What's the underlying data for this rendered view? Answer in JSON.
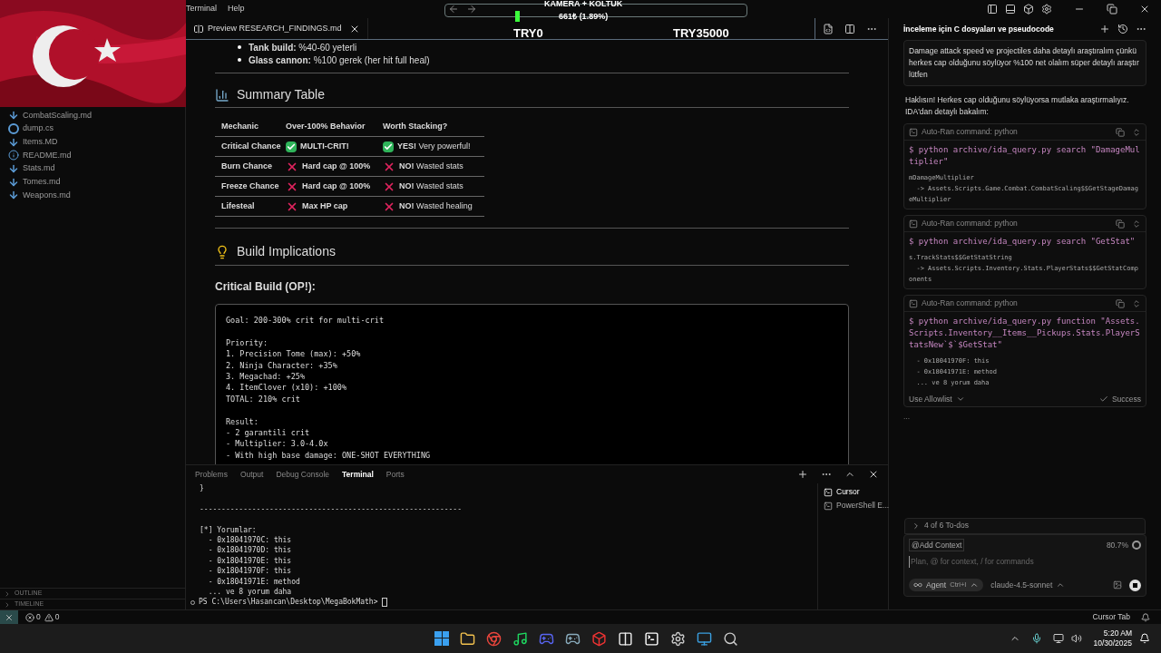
{
  "menu": [
    "Terminal",
    "Help"
  ],
  "stream_overlay": {
    "title": "KAMERA + KOLTUK",
    "amount": "661₺ (1.89%)",
    "start": "TRY0",
    "goal": "TRY35000",
    "level": 0.23
  },
  "sidebar": {
    "files": [
      {
        "name": "CombatScaling.md",
        "kind": "md"
      },
      {
        "name": "dump.cs",
        "kind": "cs"
      },
      {
        "name": "Items.MD",
        "kind": "md"
      },
      {
        "name": "README.md",
        "kind": "info"
      },
      {
        "name": "Stats.md",
        "kind": "md"
      },
      {
        "name": "Tomes.md",
        "kind": "md"
      },
      {
        "name": "Weapons.md",
        "kind": "md"
      }
    ],
    "sections": [
      {
        "label": "OUTLINE",
        "expanded": false
      },
      {
        "label": "TIMELINE",
        "expanded": false
      }
    ]
  },
  "editor_tab": {
    "label": "Preview RESEARCH_FINDINGS.md"
  },
  "preview": {
    "bullets": [
      "**Tank build:** %40-60 yeterli",
      "**Glass cannon:** %100 gerek (her hit full heal)"
    ],
    "summary_heading": "Summary Table",
    "table": {
      "columns": [
        "Mechanic",
        "Over-100% Behavior",
        "Worth Stacking?"
      ],
      "rows": [
        {
          "mechanic": "Critical Chance",
          "behavior": {
            "kind": "yes",
            "text": "MULTI-CRIT!"
          },
          "worth": {
            "kind": "yes",
            "text": "**YES!** Very powerful!"
          }
        },
        {
          "mechanic": "Burn Chance",
          "behavior": {
            "kind": "no",
            "text": "Hard cap @ 100%"
          },
          "worth": {
            "kind": "no",
            "text": "**NO!** Wasted stats"
          }
        },
        {
          "mechanic": "Freeze Chance",
          "behavior": {
            "kind": "no",
            "text": "Hard cap @ 100%"
          },
          "worth": {
            "kind": "no",
            "text": "**NO!** Wasted stats"
          }
        },
        {
          "mechanic": "Lifesteal",
          "behavior": {
            "kind": "no",
            "text": "Max HP cap"
          },
          "worth": {
            "kind": "no",
            "text": "**NO!** Wasted healing"
          }
        }
      ]
    },
    "build_heading": "Build Implications",
    "sub_heading": "Critical Build (OP!):",
    "code": [
      [
        "Goal: 200-300% crit for multi-crit"
      ],
      [
        "Priority:",
        "1. Precision Tome (max): +50%",
        "2. Ninja Character: +35%",
        "3. Megachad: +25%",
        "4. ItemClover (x10): +100%",
        "TOTAL: 210% crit"
      ],
      [
        "Result:",
        "- 2 garantili crit",
        "- Multiplier: 3.0-4.0x",
        "- With high base damage: ONE-SHOT EVERYTHING"
      ]
    ]
  },
  "panel": {
    "tabs": [
      {
        "label": "Problems",
        "selected": false
      },
      {
        "label": "Output",
        "selected": false
      },
      {
        "label": "Debug Console",
        "selected": false
      },
      {
        "label": "Terminal",
        "selected": true
      },
      {
        "label": "Ports",
        "selected": false
      }
    ],
    "terminal_lines": [
      [
        "}"
      ],
      [
        "------------------------------------------------------------"
      ],
      [
        "[*] Yorumlar:",
        "  - 0x18041970C: this",
        "  - 0x18041970D: this",
        "  - 0x18041970E: this",
        "  - 0x18041970F: this",
        "  - 0x18041971E: method",
        "  ... ve 8 yorum daha"
      ]
    ],
    "prompt": "PS C:\\Users\\Hasancan\\Desktop\\MegaBokMath> ",
    "terminals": [
      {
        "label": "Cursor",
        "selected": true
      },
      {
        "label": "PowerShell E...",
        "selected": false
      }
    ]
  },
  "chat": {
    "title": "İnceleme için C dosyaları ve pseudocode",
    "user_message": "Damage attack speed ve projectiles daha detaylı araştıralım çünkü herkes cap olduğunu söylüyor %100 net olalım süper detaylı araştır lütfen",
    "reply": "Haklısın! Herkes cap olduğunu söylüyorsa mutlaka araştırmalıyız. IDA'dan detaylı bakalım:",
    "tool_runs": [
      {
        "label": "Auto-Ran command: python",
        "command": "$ python archive/ida_query.py search \"DamageMultiplier\"",
        "output": [
          "mDamageMultiplier",
          "  -> Assets.Scripts.Game.Combat.CombatScaling$$GetStageDamageMultiplier"
        ]
      },
      {
        "label": "Auto-Ran command: python",
        "command": "$ python archive/ida_query.py search \"GetStat\"",
        "output": [
          "s.TrackStats$$GetStatString",
          "  -> Assets.Scripts.Inventory.Stats.PlayerStats$$GetStatComponents"
        ]
      },
      {
        "label": "Auto-Ran command: python",
        "command": "$ python archive/ida_query.py function \"Assets.Scripts.Inventory__Items__Pickups.Stats.PlayerStatsNew`$`$GetStat\"",
        "output": [
          "  - 0x18041970F: this",
          "  - 0x18041971E: method",
          "  ... ve 8 yorum daha"
        ],
        "allowlist": "Use Allowlist",
        "status": "Success"
      }
    ],
    "thinking": "...",
    "todos": "4 of 6 To-dos",
    "add_context": "@Add Context",
    "context_usage": "80.7%",
    "input_placeholder": "Plan, @ for context, / for commands",
    "mode": "Agent",
    "mode_shortcut": "Ctrl+I",
    "model": "claude-4.5-sonnet"
  },
  "status_bar": {
    "errors": "0",
    "warnings": "0",
    "right": "Cursor Tab"
  },
  "taskbar": {
    "time": "5:20 AM",
    "date": "10/30/2025"
  }
}
